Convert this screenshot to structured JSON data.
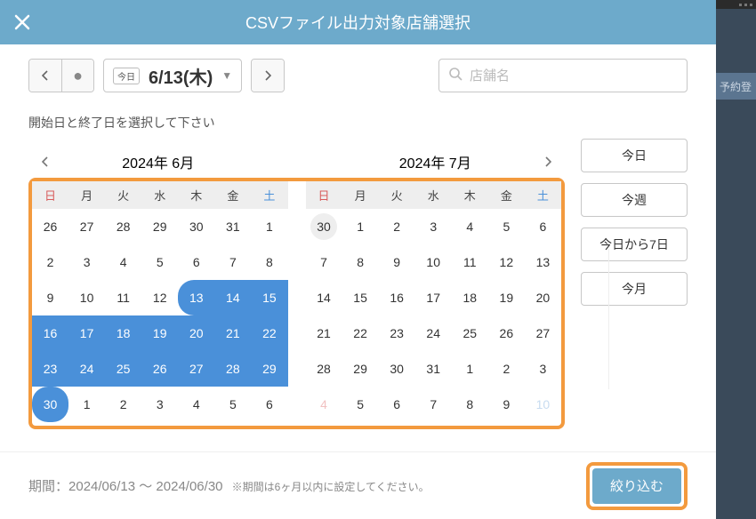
{
  "header": {
    "title": "CSVファイル出力対象店舗選択"
  },
  "toolbar": {
    "today_tag": "今日",
    "date_text": "6/13(木)",
    "search_placeholder": "店舗名"
  },
  "datepicker": {
    "instruction": "開始日と終了日を選択して下さい",
    "left": {
      "title": "2024年 6月",
      "dow": [
        "日",
        "月",
        "火",
        "水",
        "木",
        "金",
        "土"
      ],
      "rows": [
        [
          {
            "d": 26,
            "cls": "other sun"
          },
          {
            "d": 27,
            "cls": "other"
          },
          {
            "d": 28,
            "cls": "other"
          },
          {
            "d": 29,
            "cls": "other"
          },
          {
            "d": 30,
            "cls": "other"
          },
          {
            "d": 31,
            "cls": "other"
          },
          {
            "d": 1,
            "cls": "sat"
          }
        ],
        [
          {
            "d": 2,
            "cls": "sun"
          },
          {
            "d": 3,
            "cls": ""
          },
          {
            "d": 4,
            "cls": ""
          },
          {
            "d": 5,
            "cls": ""
          },
          {
            "d": 6,
            "cls": ""
          },
          {
            "d": 7,
            "cls": ""
          },
          {
            "d": 8,
            "cls": "sat"
          }
        ],
        [
          {
            "d": 9,
            "cls": "sun"
          },
          {
            "d": 10,
            "cls": ""
          },
          {
            "d": 11,
            "cls": ""
          },
          {
            "d": 12,
            "cls": ""
          },
          {
            "d": 13,
            "cls": "sel sel-start"
          },
          {
            "d": 14,
            "cls": "sel"
          },
          {
            "d": 15,
            "cls": "sel"
          }
        ],
        [
          {
            "d": 16,
            "cls": "sel"
          },
          {
            "d": 17,
            "cls": "sel"
          },
          {
            "d": 18,
            "cls": "sel"
          },
          {
            "d": 19,
            "cls": "sel"
          },
          {
            "d": 20,
            "cls": "sel"
          },
          {
            "d": 21,
            "cls": "sel"
          },
          {
            "d": 22,
            "cls": "sel"
          }
        ],
        [
          {
            "d": 23,
            "cls": "sel"
          },
          {
            "d": 24,
            "cls": "sel"
          },
          {
            "d": 25,
            "cls": "sel"
          },
          {
            "d": 26,
            "cls": "sel"
          },
          {
            "d": 27,
            "cls": "sel"
          },
          {
            "d": 28,
            "cls": "sel"
          },
          {
            "d": 29,
            "cls": "sel"
          }
        ],
        [
          {
            "d": 30,
            "cls": "sel sel-start sel-end"
          },
          {
            "d": 1,
            "cls": "other"
          },
          {
            "d": 2,
            "cls": "other"
          },
          {
            "d": 3,
            "cls": "other"
          },
          {
            "d": 4,
            "cls": "other"
          },
          {
            "d": 5,
            "cls": "other"
          },
          {
            "d": 6,
            "cls": "other"
          }
        ]
      ]
    },
    "right": {
      "title": "2024年 7月",
      "dow": [
        "日",
        "月",
        "火",
        "水",
        "木",
        "金",
        "土"
      ],
      "rows": [
        [
          {
            "d": 30,
            "cls": "other today-circle"
          },
          {
            "d": 1,
            "cls": ""
          },
          {
            "d": 2,
            "cls": ""
          },
          {
            "d": 3,
            "cls": ""
          },
          {
            "d": 4,
            "cls": ""
          },
          {
            "d": 5,
            "cls": ""
          },
          {
            "d": 6,
            "cls": "sat"
          }
        ],
        [
          {
            "d": 7,
            "cls": "sun"
          },
          {
            "d": 8,
            "cls": ""
          },
          {
            "d": 9,
            "cls": ""
          },
          {
            "d": 10,
            "cls": ""
          },
          {
            "d": 11,
            "cls": ""
          },
          {
            "d": 12,
            "cls": ""
          },
          {
            "d": 13,
            "cls": "sat"
          }
        ],
        [
          {
            "d": 14,
            "cls": "sun"
          },
          {
            "d": 15,
            "cls": "sun"
          },
          {
            "d": 16,
            "cls": ""
          },
          {
            "d": 17,
            "cls": ""
          },
          {
            "d": 18,
            "cls": ""
          },
          {
            "d": 19,
            "cls": ""
          },
          {
            "d": 20,
            "cls": "sat"
          }
        ],
        [
          {
            "d": 21,
            "cls": "sun"
          },
          {
            "d": 22,
            "cls": ""
          },
          {
            "d": 23,
            "cls": ""
          },
          {
            "d": 24,
            "cls": ""
          },
          {
            "d": 25,
            "cls": ""
          },
          {
            "d": 26,
            "cls": ""
          },
          {
            "d": 27,
            "cls": "sat"
          }
        ],
        [
          {
            "d": 28,
            "cls": "sun"
          },
          {
            "d": 29,
            "cls": ""
          },
          {
            "d": 30,
            "cls": ""
          },
          {
            "d": 31,
            "cls": ""
          },
          {
            "d": 1,
            "cls": "other"
          },
          {
            "d": 2,
            "cls": "other"
          },
          {
            "d": 3,
            "cls": "other"
          }
        ],
        [
          {
            "d": 4,
            "cls": "other soft"
          },
          {
            "d": 5,
            "cls": "other"
          },
          {
            "d": 6,
            "cls": "other"
          },
          {
            "d": 7,
            "cls": "other"
          },
          {
            "d": 8,
            "cls": "other"
          },
          {
            "d": 9,
            "cls": "other"
          },
          {
            "d": 10,
            "cls": "other softb"
          }
        ]
      ]
    }
  },
  "quick": {
    "today": "今日",
    "this_week": "今週",
    "seven_days": "今日から7日",
    "this_month": "今月"
  },
  "footer": {
    "period_label": "期間：",
    "period_value": "2024/06/13 ～ 2024/06/30",
    "note": "※期間は6ヶ月以内に設定してください。",
    "filter": "絞り込む"
  },
  "behind": {
    "button": "予約登"
  }
}
